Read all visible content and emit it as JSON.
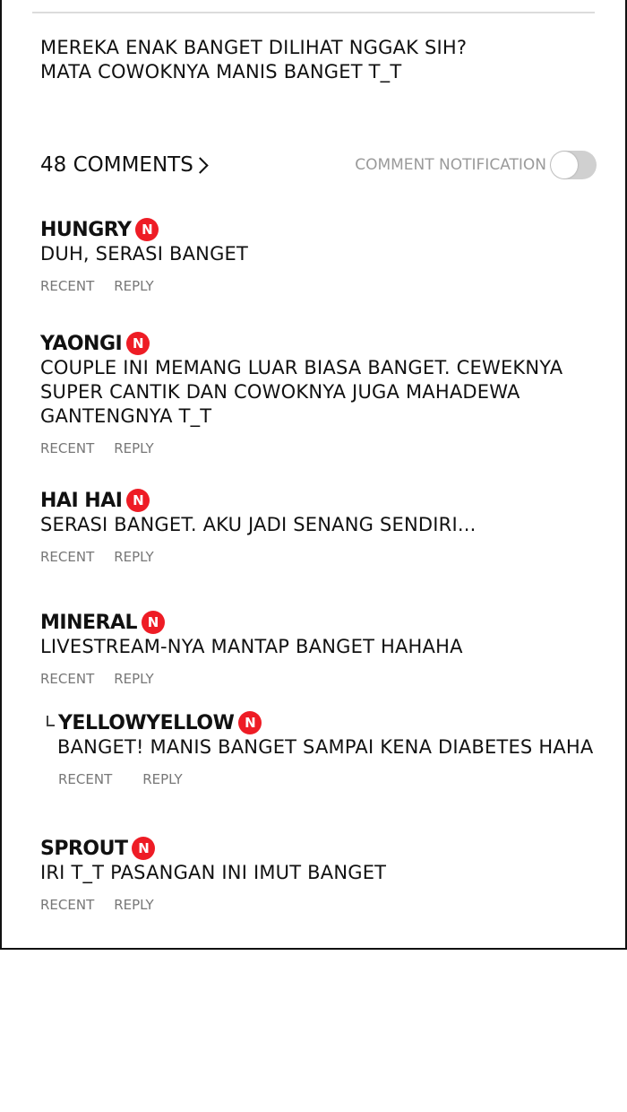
{
  "post": {
    "caption_line1": "MEREKA ENAK BANGET DILIHAT NGGAK SIH?",
    "caption_line2": "MATA COWOKNYA MANIS BANGET T_T"
  },
  "comments_header": {
    "count_label": "48 COMMENTS",
    "notification_label": "COMMENT NOTIFICATION",
    "notification_enabled": false
  },
  "badge_label": "N",
  "badge_color": "#ee1c25",
  "action_labels": {
    "recent": "RECENT",
    "reply": "REPLY"
  },
  "comments": [
    {
      "name": "HUNGRY",
      "lines": [
        "DUH, SERASI BANGET"
      ]
    },
    {
      "name": "YAONGI",
      "lines": [
        "COUPLE INI MEMANG LUAR BIASA BANGET. CEWEKNYA",
        "SUPER CANTIK DAN COWOKNYA JUGA MAHADEWA",
        "GANTENGNYA T_T"
      ]
    },
    {
      "name": "HAI HAI",
      "lines": [
        "SERASI BANGET. AKU JADI SENANG SENDIRI..."
      ]
    },
    {
      "name": "MINERAL",
      "lines": [
        "LIVESTREAM-NYA MANTAP BANGET HAHAHA"
      ]
    },
    {
      "name": "YELLOWYELLOW",
      "is_reply": true,
      "lines": [
        "BANGET! MANIS BANGET SAMPAI KENA DIABETES HAHA"
      ]
    },
    {
      "name": "SPROUT",
      "lines": [
        "IRI T_T PASANGAN INI IMUT BANGET"
      ]
    }
  ]
}
